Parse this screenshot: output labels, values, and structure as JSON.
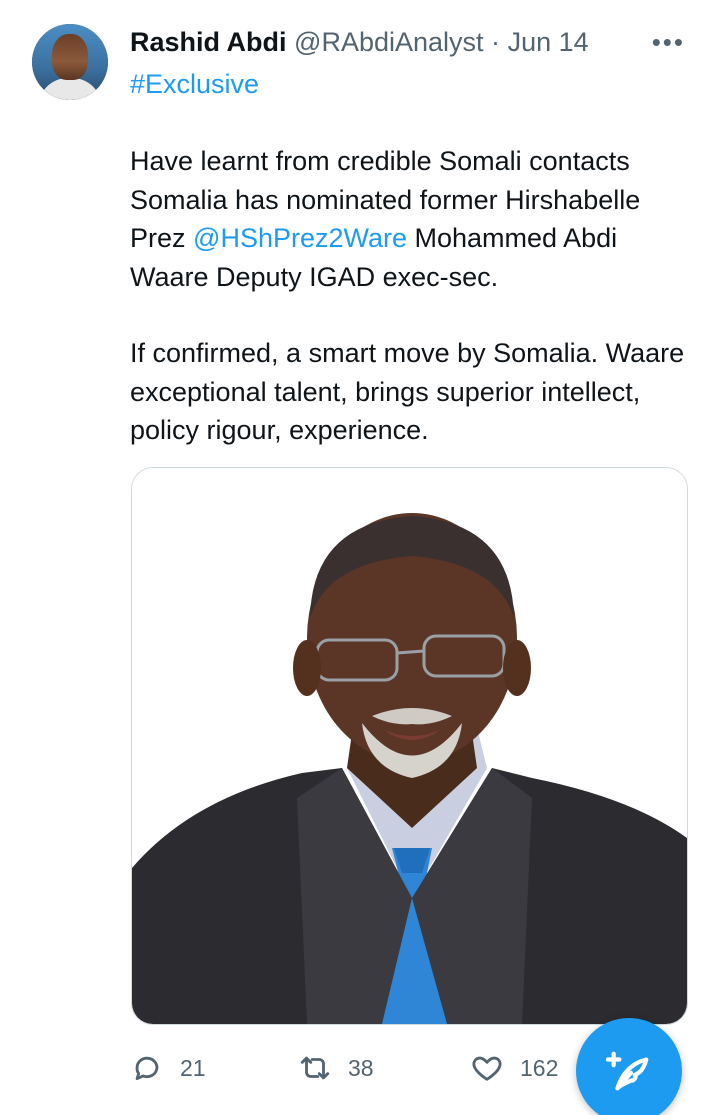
{
  "author": {
    "name": "Rashid Abdi",
    "handle": "@RAbdiAnalyst",
    "separator": "·",
    "date": "Jun 14"
  },
  "more_label": "•••",
  "tweet": {
    "hashtag": "#Exclusive",
    "paragraph1_part1": "Have learnt from credible Somali contacts Somalia has nominated former Hirshabelle Prez ",
    "mention": "@HShPrez2Ware",
    "paragraph1_part2": "  Mohammed Abdi Waare Deputy IGAD exec-sec.",
    "paragraph2": "If confirmed, a smart move by Somalia. Waare exceptional talent, brings superior intellect, policy rigour, experience."
  },
  "actions": {
    "replies": "21",
    "retweets": "38",
    "likes": "162"
  },
  "icons": {
    "reply": "reply-icon",
    "retweet": "retweet-icon",
    "like": "heart-icon",
    "compose": "compose-icon",
    "more": "more-icon"
  },
  "colors": {
    "accent": "#1d9bf0",
    "text": "#0f1419",
    "secondary": "#536471"
  }
}
